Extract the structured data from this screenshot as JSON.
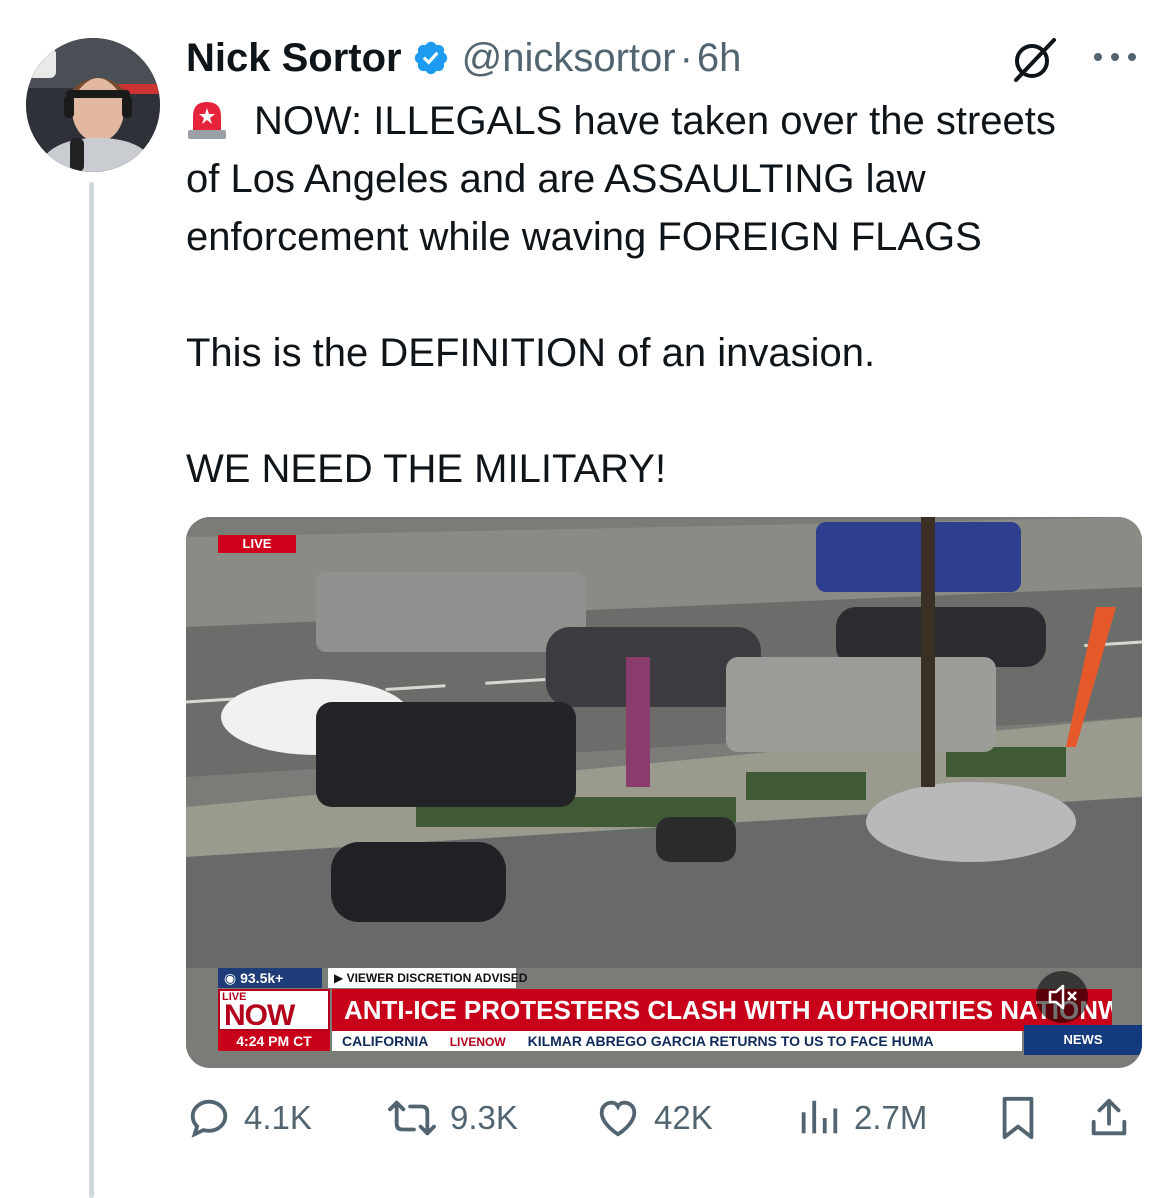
{
  "author": {
    "name": "Nick Sortor",
    "handle": "@nicksortor",
    "separator": "·",
    "time": "6h",
    "verified": true,
    "avatar_icon": "avatar-photo"
  },
  "tweet": {
    "lines": [
      "NOW: ILLEGALS have taken over the streets",
      "of Los Angeles and are ASSAULTING law",
      "enforcement while waving FOREIGN FLAGS",
      "This is the DEFINITION of an invasion.",
      "WE NEED THE MILITARY!"
    ],
    "emoji": "rotating-light-siren"
  },
  "video": {
    "live_badge": "LIVE",
    "viewers": "93.5k+",
    "discretion": "VIEWER DISCRETION ADVISED",
    "network_small": "LIVE",
    "network_big": "NOW",
    "headline": "ANTI-ICE PROTESTERS CLASH WITH AUTHORITIES NATIONWIDE",
    "time": "4:24 PM CT",
    "ticker_location": "CALIFORNIA",
    "ticker_brand": "LIVENOW",
    "ticker_story": "KILMAR ABREGO GARCIA RETURNS TO US TO FACE HUMA",
    "news_label": "NEWS",
    "mute_icon": "speaker-muted-icon"
  },
  "actions": {
    "replies": "4.1K",
    "reposts": "9.3K",
    "likes": "42K",
    "views": "2.7M"
  },
  "colors": {
    "text": "#0f1419",
    "secondary": "#536471",
    "verified_blue": "#1d9bf0",
    "thread_line": "#cfd9de",
    "headline_red": "#c8001a"
  }
}
